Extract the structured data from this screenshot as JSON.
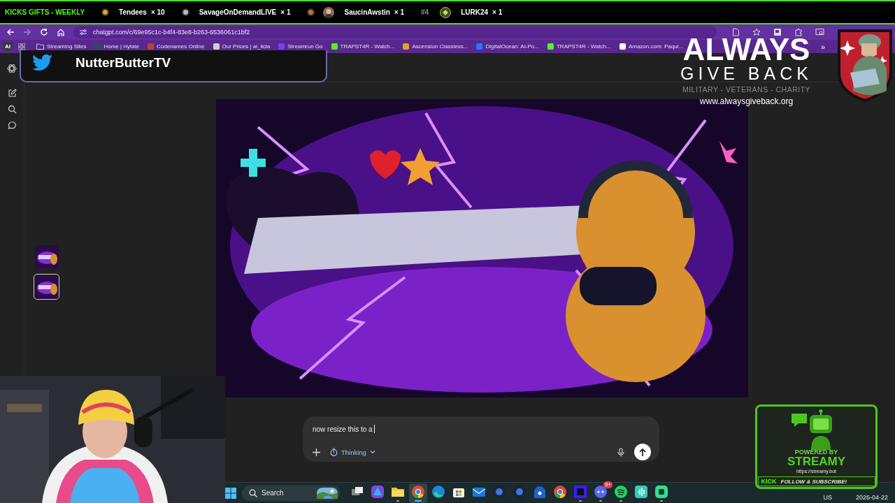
{
  "ticker": {
    "title": "KICKS GIFTS - WEEKLY",
    "entries": [
      {
        "kind": "medal",
        "color": "#d9a52b",
        "name": "Tendees",
        "count": "× 10"
      },
      {
        "kind": "medal",
        "color": "#b4bcc6",
        "name": "SavageOnDemandLIVE",
        "count": "× 1"
      },
      {
        "kind": "medal",
        "color": "#c0703a",
        "avatar": {
          "kind": "person"
        },
        "name": "SaucinAwstin",
        "count": "× 1"
      },
      {
        "kind": "rank",
        "rank": "#4",
        "avatar": {
          "kind": "emblem"
        },
        "name": "LURK24",
        "count": "× 1"
      }
    ]
  },
  "browser": {
    "url": "chatgpt.com/c/69e95c1c-b4f4-83e8-b263-6536061c1bf2",
    "group_label": "AI",
    "bookmarks": [
      {
        "kind": "folder",
        "title": "Streaming Sites"
      },
      {
        "kind": "site",
        "color": "#2f4a5e",
        "title": "Home | Hytale"
      },
      {
        "kind": "site",
        "color": "#c2412a",
        "title": "Codenames Online"
      },
      {
        "kind": "site",
        "color": "#cfcfcf",
        "title": "Our Prices | ai_licia"
      },
      {
        "kind": "site",
        "color": "#7a3cff",
        "title": "Streamrun Go"
      },
      {
        "kind": "site",
        "color": "#53fc18",
        "title": "TRAPST4R - Watch..."
      },
      {
        "kind": "site",
        "color": "#e0a020",
        "title": "Ascension Classless..."
      },
      {
        "kind": "site",
        "color": "#1a7cff",
        "title": "DigitalOcean: AI-Po..."
      },
      {
        "kind": "site",
        "color": "#53fc18",
        "title": "TRAPST4R - Watch..."
      },
      {
        "kind": "site",
        "color": "#ffffff",
        "title": "Amazon.com: Paqui..."
      }
    ],
    "overflow": "»"
  },
  "chat": {
    "thumbnails": [
      {
        "selected": false
      },
      {
        "selected": true
      }
    ],
    "composer": {
      "value": "now resize this to a",
      "mode": "Thinking"
    }
  },
  "taskbar": {
    "search": {
      "label": "Search"
    },
    "apps": [
      {
        "kind": "taskview",
        "running": false,
        "selected": false
      },
      {
        "kind": "suite",
        "running": false,
        "selected": false
      },
      {
        "kind": "folder",
        "running": true,
        "selected": false
      },
      {
        "kind": "chrome",
        "running": true,
        "selected": true
      },
      {
        "kind": "edge",
        "running": false,
        "selected": false
      },
      {
        "kind": "store",
        "running": false,
        "selected": false
      },
      {
        "kind": "mail",
        "running": false,
        "selected": false
      },
      {
        "kind": "game",
        "running": false,
        "selected": false
      },
      {
        "kind": "game",
        "running": false,
        "selected": false
      },
      {
        "kind": "vpn",
        "running": false,
        "selected": false
      },
      {
        "kind": "chrome",
        "running": false,
        "selected": false
      },
      {
        "kind": "square",
        "running": true,
        "selected": false
      },
      {
        "kind": "discord",
        "badge": "9+",
        "running": true,
        "selected": false
      },
      {
        "kind": "spotify",
        "running": true,
        "selected": false
      },
      {
        "kind": "audio",
        "running": false,
        "selected": false
      },
      {
        "kind": "green",
        "running": true,
        "selected": false
      }
    ],
    "tray": {
      "language": "US",
      "date": "2026-04-22"
    }
  },
  "overlays": {
    "twitter": {
      "handle": "NutterButterTV"
    },
    "charity": {
      "line1": "ALWAYS",
      "line2": "GIVE BACK",
      "tagline": "MILITARY - VETERANS - CHARITY",
      "url": "www.alwaysgiveback.org"
    },
    "streamy": {
      "top": "POWERED BY",
      "brand": "STREAMY",
      "url": "https://streamy.bot",
      "platform": "KICK",
      "cta": "FOLLOW & SUBSCRIBE!"
    }
  }
}
